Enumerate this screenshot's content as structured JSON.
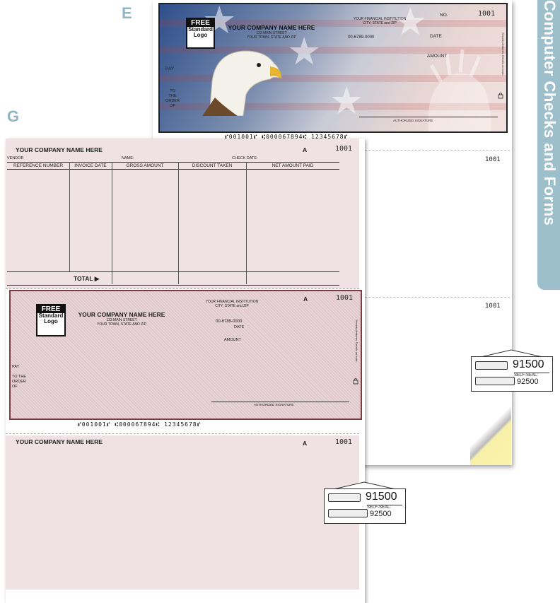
{
  "side_tab": {
    "label": "Computer Checks and Forms"
  },
  "labels": {
    "e": "E",
    "g": "G"
  },
  "logo": {
    "line1": "FREE",
    "line2": "Standard",
    "line3": "Logo"
  },
  "company": {
    "name": "YOUR COMPANY NAME HERE",
    "street": "123 MAIN STREET",
    "city_e": "YOUR TOWN, STATE AND ZIP",
    "city_g": "YOUR TOWN, STATE AND ZIP"
  },
  "bank": {
    "name": "YOUR FINANCIAL INSTITUTION",
    "city": "CITY, STATE and ZIP",
    "routing": "00-6789-0000"
  },
  "check_e": {
    "no_label": "NO.",
    "number": "1001",
    "date_label": "DATE",
    "amount_label": "AMOUNT",
    "pay_label": "PAY",
    "to_order": [
      "TO",
      "THE",
      "ORDER",
      "OF"
    ],
    "signature_label": "AUTHORIZED SIGNATURE",
    "security_note": "Security features. Details on back.",
    "micr": "⑈001001⑈ ⑆000067894⑆ 12345678⑈"
  },
  "sheet_e_lower": {
    "number_1": "1001",
    "number_2": "1001"
  },
  "seal_e": {
    "value": "91500",
    "note": "SELF-SEAL:",
    "value2": "92500"
  },
  "seal_g": {
    "value": "91500",
    "note": "SELF-SEAL:",
    "value2": "92500"
  },
  "stub": {
    "company": "YOUR COMPANY NAME HERE",
    "letter": "A",
    "number": "1001",
    "vendor_label": "VENDOR",
    "name_label": "NAME:",
    "check_date_label": "CHECK DATE:",
    "columns": [
      "REFERENCE NUMBER",
      "INVOICE DATE",
      "GROSS AMOUNT",
      "DISCOUNT TAKEN",
      "NET AMOUNT PAID"
    ],
    "total_label": "TOTAL ▶"
  },
  "check_g": {
    "letter": "A",
    "number": "1001",
    "date_label": "DATE",
    "amount_label": "AMOUNT",
    "pay_label": "PAY",
    "to_order": [
      "TO THE",
      "ORDER",
      "OF"
    ],
    "signature_label": "AUTHORIZED SIGNATURE",
    "security_note": "Security features. Details on back.",
    "micr": "⑈001001⑈ ⑆000067894⑆ 12345678⑈"
  },
  "stub2": {
    "company": "YOUR COMPANY NAME HERE",
    "letter": "A",
    "number": "1001"
  }
}
